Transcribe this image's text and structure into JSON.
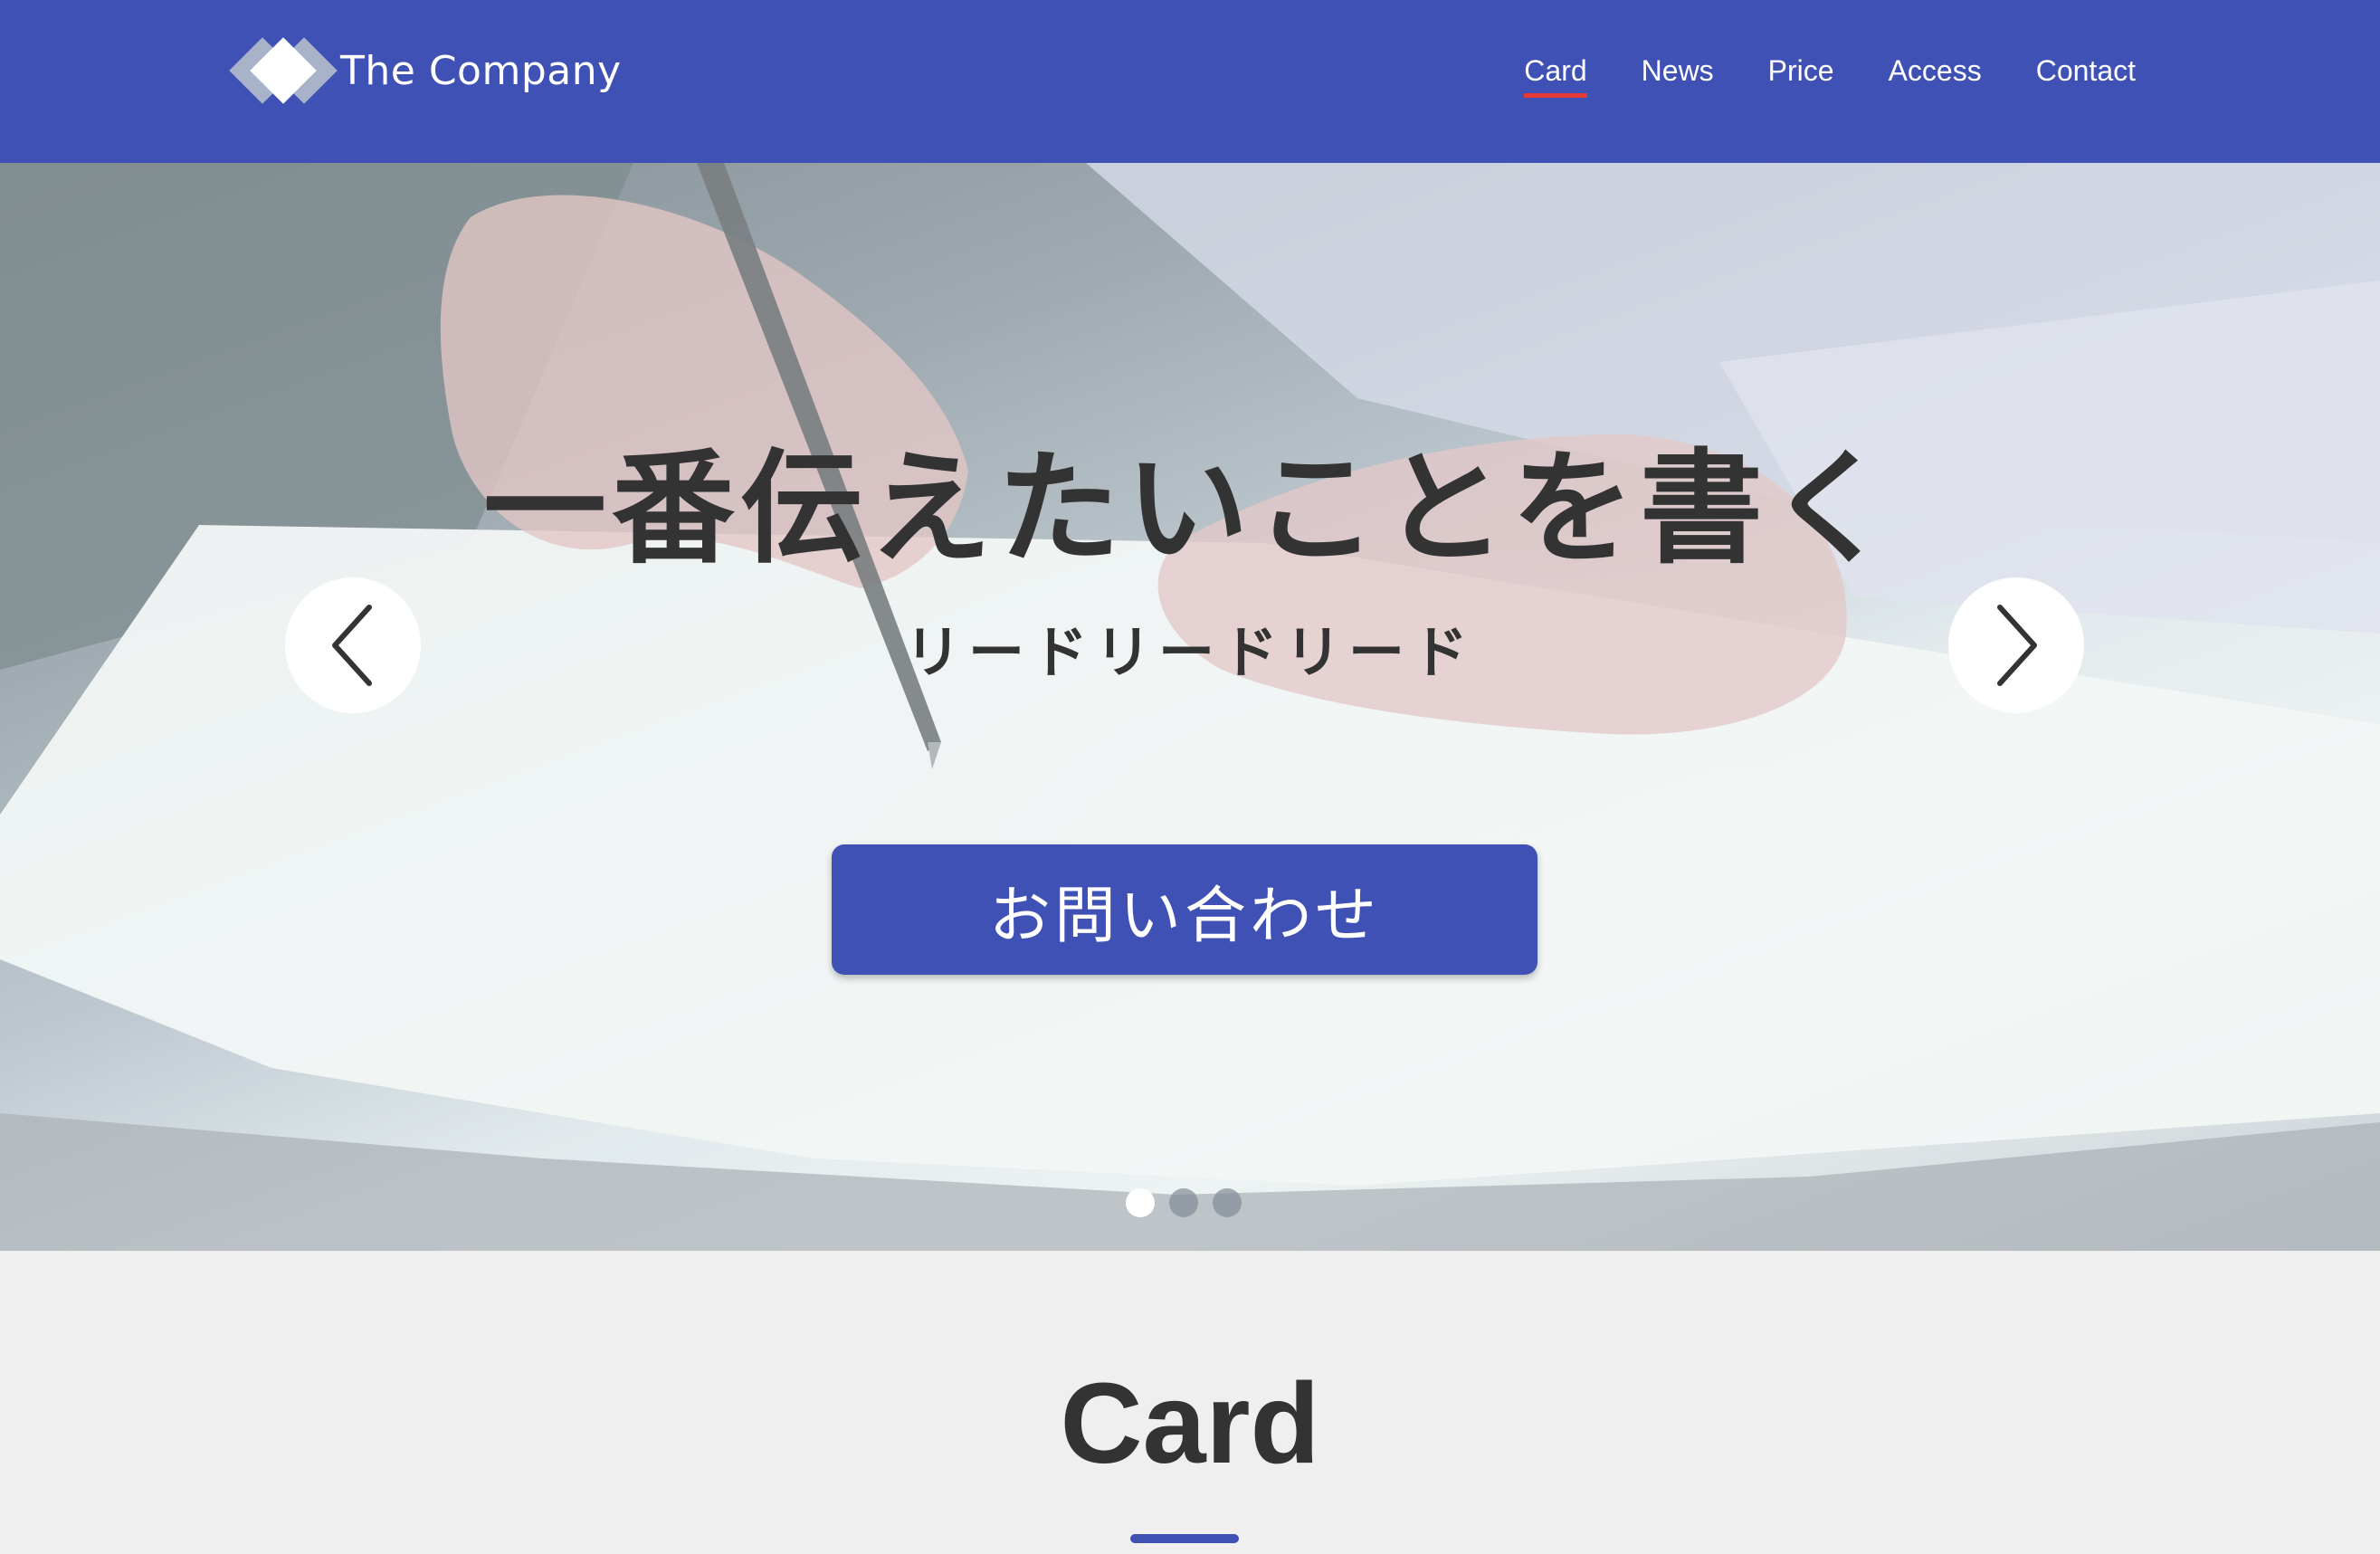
{
  "header": {
    "logo_text": "The Company",
    "nav": [
      {
        "label": "Card",
        "active": true
      },
      {
        "label": "News",
        "active": false
      },
      {
        "label": "Price",
        "active": false
      },
      {
        "label": "Access",
        "active": false
      },
      {
        "label": "Contact",
        "active": false
      }
    ]
  },
  "hero": {
    "title": "一番伝えたいことを書く",
    "lead": "リードリードリード",
    "cta_label": "お問い合わせ",
    "prev_icon": "chevron-left-icon",
    "next_icon": "chevron-right-icon",
    "slides": 3,
    "active_slide": 1
  },
  "card_section": {
    "title": "Card"
  },
  "colors": {
    "primary": "#3f51b5",
    "nav_active_underline": "#e53935",
    "text_dark": "#333333",
    "background": "#efefef"
  }
}
